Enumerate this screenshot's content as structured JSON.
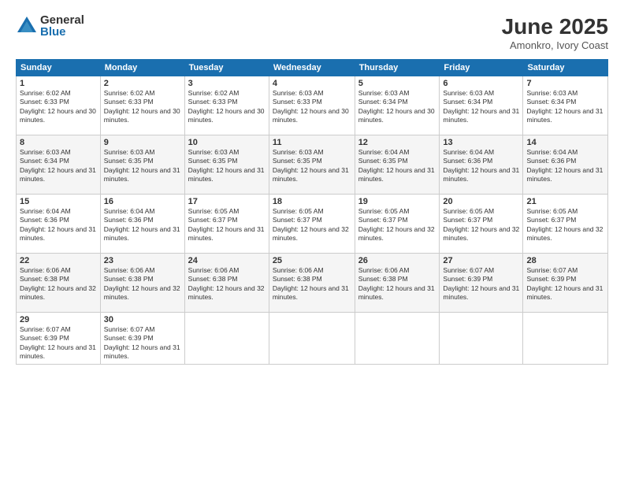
{
  "logo": {
    "general": "General",
    "blue": "Blue"
  },
  "title": {
    "month": "June 2025",
    "location": "Amonkro, Ivory Coast"
  },
  "weekdays": [
    "Sunday",
    "Monday",
    "Tuesday",
    "Wednesday",
    "Thursday",
    "Friday",
    "Saturday"
  ],
  "weeks": [
    [
      {
        "day": "1",
        "sunrise": "6:02 AM",
        "sunset": "6:33 PM",
        "daylight": "12 hours and 30 minutes."
      },
      {
        "day": "2",
        "sunrise": "6:02 AM",
        "sunset": "6:33 PM",
        "daylight": "12 hours and 30 minutes."
      },
      {
        "day": "3",
        "sunrise": "6:02 AM",
        "sunset": "6:33 PM",
        "daylight": "12 hours and 30 minutes."
      },
      {
        "day": "4",
        "sunrise": "6:03 AM",
        "sunset": "6:33 PM",
        "daylight": "12 hours and 30 minutes."
      },
      {
        "day": "5",
        "sunrise": "6:03 AM",
        "sunset": "6:34 PM",
        "daylight": "12 hours and 30 minutes."
      },
      {
        "day": "6",
        "sunrise": "6:03 AM",
        "sunset": "6:34 PM",
        "daylight": "12 hours and 31 minutes."
      },
      {
        "day": "7",
        "sunrise": "6:03 AM",
        "sunset": "6:34 PM",
        "daylight": "12 hours and 31 minutes."
      }
    ],
    [
      {
        "day": "8",
        "sunrise": "6:03 AM",
        "sunset": "6:34 PM",
        "daylight": "12 hours and 31 minutes."
      },
      {
        "day": "9",
        "sunrise": "6:03 AM",
        "sunset": "6:35 PM",
        "daylight": "12 hours and 31 minutes."
      },
      {
        "day": "10",
        "sunrise": "6:03 AM",
        "sunset": "6:35 PM",
        "daylight": "12 hours and 31 minutes."
      },
      {
        "day": "11",
        "sunrise": "6:03 AM",
        "sunset": "6:35 PM",
        "daylight": "12 hours and 31 minutes."
      },
      {
        "day": "12",
        "sunrise": "6:04 AM",
        "sunset": "6:35 PM",
        "daylight": "12 hours and 31 minutes."
      },
      {
        "day": "13",
        "sunrise": "6:04 AM",
        "sunset": "6:36 PM",
        "daylight": "12 hours and 31 minutes."
      },
      {
        "day": "14",
        "sunrise": "6:04 AM",
        "sunset": "6:36 PM",
        "daylight": "12 hours and 31 minutes."
      }
    ],
    [
      {
        "day": "15",
        "sunrise": "6:04 AM",
        "sunset": "6:36 PM",
        "daylight": "12 hours and 31 minutes."
      },
      {
        "day": "16",
        "sunrise": "6:04 AM",
        "sunset": "6:36 PM",
        "daylight": "12 hours and 31 minutes."
      },
      {
        "day": "17",
        "sunrise": "6:05 AM",
        "sunset": "6:37 PM",
        "daylight": "12 hours and 31 minutes."
      },
      {
        "day": "18",
        "sunrise": "6:05 AM",
        "sunset": "6:37 PM",
        "daylight": "12 hours and 32 minutes."
      },
      {
        "day": "19",
        "sunrise": "6:05 AM",
        "sunset": "6:37 PM",
        "daylight": "12 hours and 32 minutes."
      },
      {
        "day": "20",
        "sunrise": "6:05 AM",
        "sunset": "6:37 PM",
        "daylight": "12 hours and 32 minutes."
      },
      {
        "day": "21",
        "sunrise": "6:05 AM",
        "sunset": "6:37 PM",
        "daylight": "12 hours and 32 minutes."
      }
    ],
    [
      {
        "day": "22",
        "sunrise": "6:06 AM",
        "sunset": "6:38 PM",
        "daylight": "12 hours and 32 minutes."
      },
      {
        "day": "23",
        "sunrise": "6:06 AM",
        "sunset": "6:38 PM",
        "daylight": "12 hours and 32 minutes."
      },
      {
        "day": "24",
        "sunrise": "6:06 AM",
        "sunset": "6:38 PM",
        "daylight": "12 hours and 32 minutes."
      },
      {
        "day": "25",
        "sunrise": "6:06 AM",
        "sunset": "6:38 PM",
        "daylight": "12 hours and 31 minutes."
      },
      {
        "day": "26",
        "sunrise": "6:06 AM",
        "sunset": "6:38 PM",
        "daylight": "12 hours and 31 minutes."
      },
      {
        "day": "27",
        "sunrise": "6:07 AM",
        "sunset": "6:39 PM",
        "daylight": "12 hours and 31 minutes."
      },
      {
        "day": "28",
        "sunrise": "6:07 AM",
        "sunset": "6:39 PM",
        "daylight": "12 hours and 31 minutes."
      }
    ],
    [
      {
        "day": "29",
        "sunrise": "6:07 AM",
        "sunset": "6:39 PM",
        "daylight": "12 hours and 31 minutes."
      },
      {
        "day": "30",
        "sunrise": "6:07 AM",
        "sunset": "6:39 PM",
        "daylight": "12 hours and 31 minutes."
      },
      null,
      null,
      null,
      null,
      null
    ]
  ]
}
